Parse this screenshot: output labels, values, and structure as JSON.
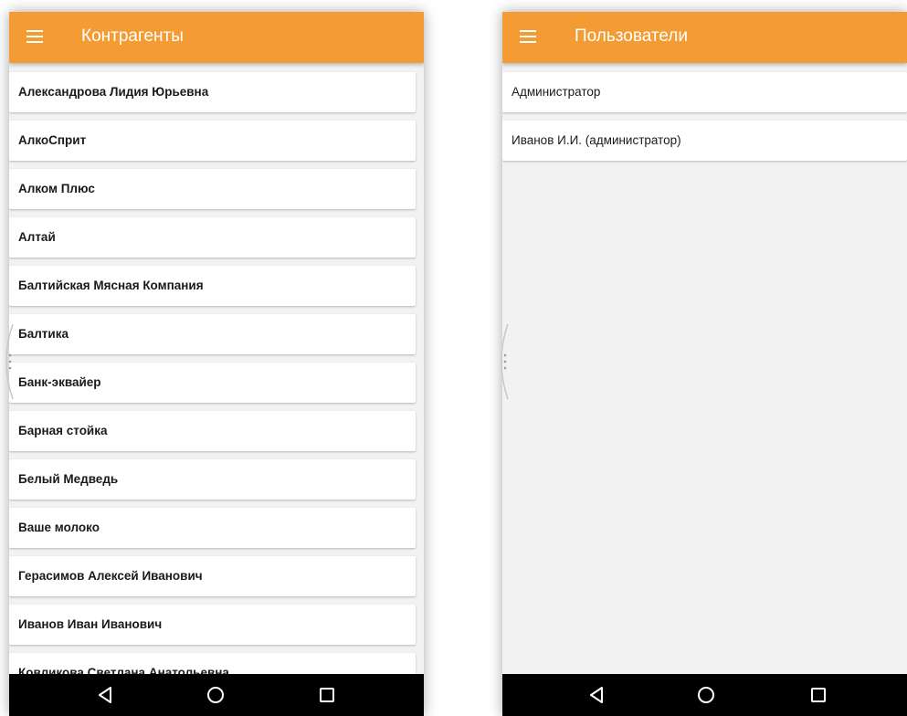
{
  "left_screen": {
    "title": "Контрагенты",
    "items": [
      "Александрова Лидия Юрьевна",
      "АлкоСприт",
      "Алком Плюс",
      "Алтай",
      "Балтийская Мясная Компания",
      "Балтика",
      "Банк-эквайер",
      "Барная стойка",
      "Белый Медведь",
      "Ваше молоко",
      "Герасимов Алексей Иванович",
      "Иванов Иван Иванович",
      "Ковликова Светлана Анатольевна"
    ]
  },
  "right_screen": {
    "title": "Пользователи",
    "items": [
      "Администратор",
      "Иванов И.И. (администратор)"
    ]
  },
  "icons": {
    "menu": "hamburger-menu-icon",
    "back": "back-triangle-icon",
    "home": "home-circle-icon",
    "recents": "recents-square-icon"
  },
  "colors": {
    "header": "#f39c34",
    "background": "#f2f2f2",
    "nav_bar": "#000000"
  }
}
